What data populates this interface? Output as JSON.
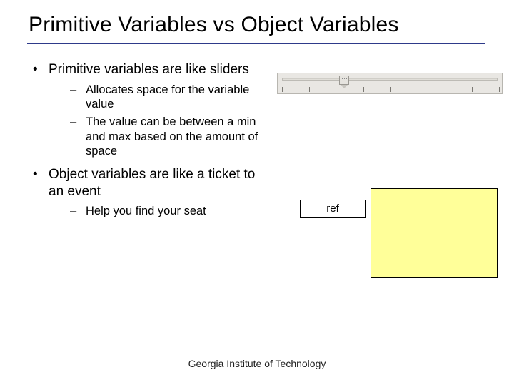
{
  "title": "Primitive Variables vs Object Variables",
  "bullets": {
    "b1": "Primitive variables are like sliders",
    "b1_sub1": "Allocates space for the variable value",
    "b1_sub2": "The value can be between a min and max based on the amount of space",
    "b2": "Object variables are like a ticket to an event",
    "b2_sub1": "Help you find your seat"
  },
  "ref_label": "ref",
  "footer": "Georgia Institute of Technology",
  "slider": {
    "ticks": 9,
    "thumb_position_pct": 29
  }
}
